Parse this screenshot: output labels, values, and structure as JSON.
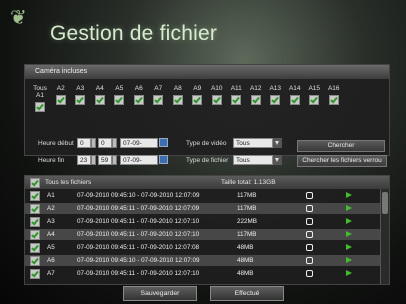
{
  "title": "Gestion de fichier",
  "cameras": {
    "header": "Caméra incluses",
    "labels": [
      "Tous A1",
      "A2",
      "A3",
      "A4",
      "A5",
      "A6",
      "A7",
      "A8",
      "A9",
      "A10",
      "A11",
      "A12",
      "A13",
      "A14",
      "A15",
      "A16"
    ]
  },
  "filters": {
    "start_label": "Heure début",
    "start_h": "0",
    "start_m": "0",
    "start_date": "07-09-2010",
    "end_label": "Heure fin",
    "end_h": "23",
    "end_m": "59",
    "end_date": "07-09-2010",
    "video_type_label": "Type de vidéo",
    "video_type_value": "Tous",
    "file_type_label": "Type de fichier",
    "file_type_value": "Tous",
    "search_button": "Chercher",
    "search_locked_button": "Chercher les fichiers verrou"
  },
  "files": {
    "all_label": "Tous les fichiers",
    "total_label": "Taille total: 1.13GB",
    "rows": [
      {
        "cam": "A1",
        "time": "07-09-2010 09:45:10 - 07-09-2010 12:07:09",
        "size": "117MB"
      },
      {
        "cam": "A2",
        "time": "07-09-2010 09:45:11 - 07-09-2010 12:07:09",
        "size": "117MB"
      },
      {
        "cam": "A3",
        "time": "07-09-2010 09:45:11 - 07-09-2010 12:07:10",
        "size": "222MB"
      },
      {
        "cam": "A4",
        "time": "07-09-2010 09:45:11 - 07-09-2010 12:07:10",
        "size": "117MB"
      },
      {
        "cam": "A5",
        "time": "07-09-2010 09:45:11 - 07-09-2010 12:07:08",
        "size": "48MB"
      },
      {
        "cam": "A6",
        "time": "07-09-2010 09:45:10 - 07-09-2010 12:07:09",
        "size": "48MB"
      },
      {
        "cam": "A7",
        "time": "07-09-2010 09:45:11 - 07-09-2010 12:07:10",
        "size": "48MB"
      }
    ]
  },
  "buttons": {
    "save": "Sauvegarder",
    "clear": "Effectué"
  },
  "colors": {
    "check": "#2d9a28",
    "play": "#3fbf2a",
    "accent": "#3a6fb8"
  }
}
